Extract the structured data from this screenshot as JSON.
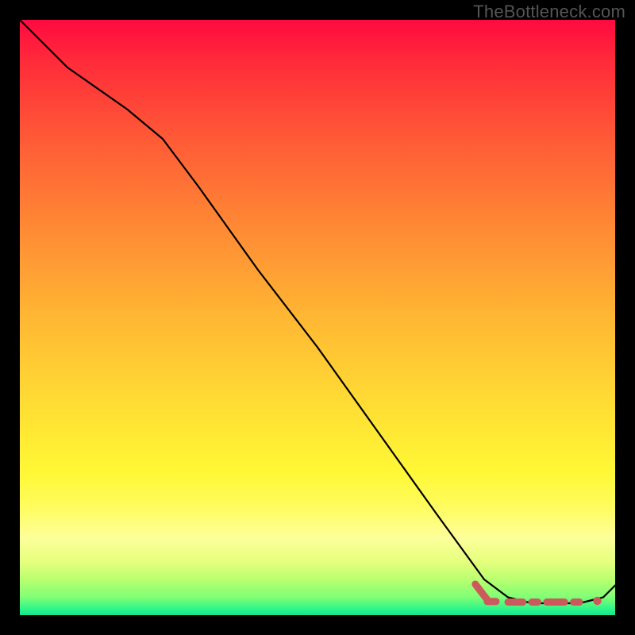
{
  "watermark": "TheBottleneck.com",
  "chart_data": {
    "type": "line",
    "title": "",
    "xlabel": "",
    "ylabel": "",
    "xlim": [
      0,
      100
    ],
    "ylim": [
      0,
      100
    ],
    "grid": false,
    "legend": false,
    "background": "rainbow-vertical",
    "series": [
      {
        "name": "curve",
        "x": [
          0,
          8,
          18,
          24,
          30,
          40,
          50,
          60,
          70,
          78,
          82,
          86,
          90,
          94,
          98,
          100
        ],
        "values": [
          100,
          92,
          85,
          80,
          72,
          58,
          45,
          31,
          17,
          6,
          3,
          2,
          2,
          2,
          3,
          5
        ]
      }
    ],
    "annotations": {
      "bottom_marker": {
        "segments": [
          {
            "x0": 78.5,
            "x1": 80.0,
            "y": 2.3
          },
          {
            "x0": 82.0,
            "x1": 84.5,
            "y": 2.2
          },
          {
            "x0": 86.0,
            "x1": 87.0,
            "y": 2.2
          },
          {
            "x0": 88.5,
            "x1": 91.5,
            "y": 2.2
          },
          {
            "x0": 93.0,
            "x1": 94.0,
            "y": 2.2
          }
        ],
        "end_dot": {
          "x": 97.0,
          "y": 2.4,
          "r": 0.7
        },
        "lead_in": {
          "x0": 76.5,
          "y0": 5.2,
          "x1": 78.5,
          "y1": 2.6
        }
      }
    }
  }
}
